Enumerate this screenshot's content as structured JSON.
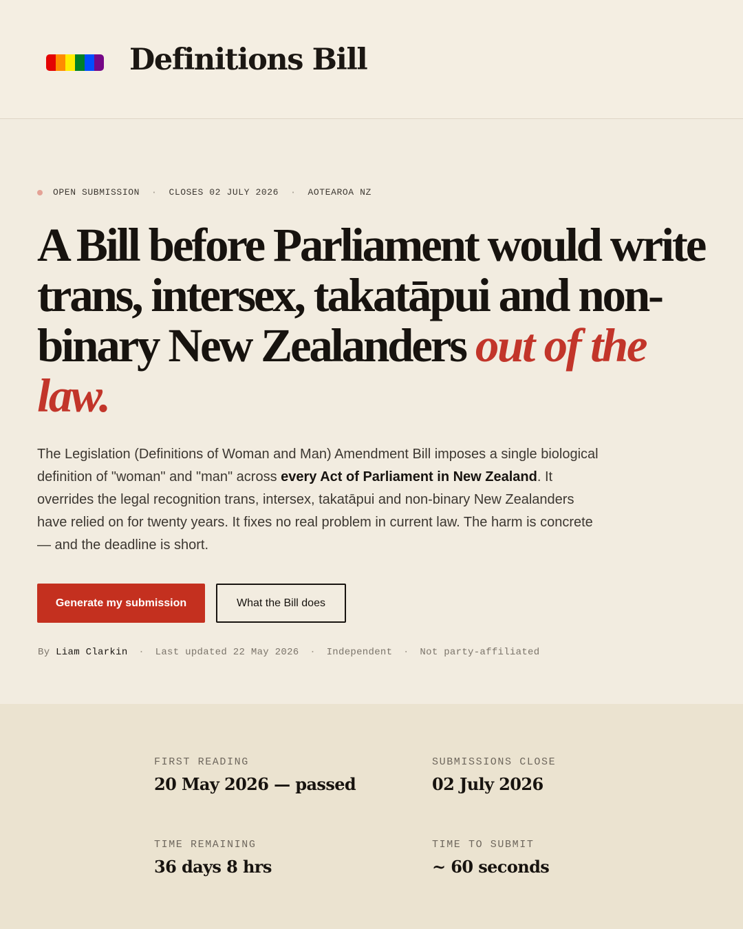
{
  "header": {
    "site_title": "Definitions Bill",
    "flag_colors": [
      "#e40303",
      "#ff8c00",
      "#ffed00",
      "#008026",
      "#004dff",
      "#750787"
    ]
  },
  "hero": {
    "eyebrow": {
      "status": "OPEN SUBMISSION",
      "separator": "·",
      "closes": "CLOSES 02 JULY 2026",
      "region": "AOTEAROA NZ"
    },
    "headline": {
      "main": "A Bill before Parliament would write trans, intersex, takatāpui and non-binary New Zealanders",
      "accent": "out of the law."
    },
    "lede": {
      "part1": "The Legislation (Definitions of Woman and Man) Amendment Bill imposes a single biological definition of \"woman\" and \"man\" across ",
      "emphasis": "every Act of Parliament in New Zealand",
      "part2": ". It overrides the legal recognition trans, intersex, takatāpui and non-binary New Zealanders have relied on for twenty years. It fixes no real problem in current law. The harm is concrete — and the deadline is short."
    },
    "buttons": {
      "primary": "Generate my submission",
      "secondary": "What the Bill does"
    },
    "byline": {
      "by": "By",
      "author": "Liam Clarkin",
      "separator": "·",
      "updated": "Last updated 22 May 2026",
      "independent": "Independent",
      "affiliation": "Not party-affiliated"
    }
  },
  "stats": [
    {
      "label": "FIRST READING",
      "value": "20 May 2026 — passed"
    },
    {
      "label": "SUBMISSIONS CLOSE",
      "value": "02 July 2026"
    },
    {
      "label": "TIME REMAINING",
      "value": "36 days 8 hrs"
    },
    {
      "label": "TIME TO SUBMIT",
      "value": "~ 60 seconds"
    }
  ],
  "colors": {
    "accent": "#c2352a",
    "button": "#c4301f",
    "status_dot": "#e4a296"
  }
}
